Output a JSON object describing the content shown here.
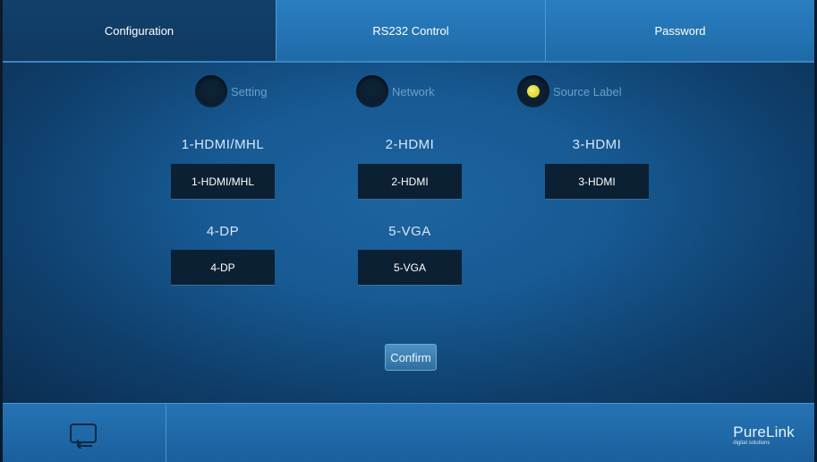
{
  "tabs": [
    {
      "label": "Configuration",
      "active": true
    },
    {
      "label": "RS232 Control",
      "active": false
    },
    {
      "label": "Password",
      "active": false
    }
  ],
  "mode_options": [
    {
      "label": "Setting",
      "selected": false
    },
    {
      "label": "Network",
      "selected": false
    },
    {
      "label": "Source Label",
      "selected": true
    }
  ],
  "sources": [
    {
      "title": "1-HDMI/MHL",
      "value": "1-HDMI/MHL"
    },
    {
      "title": "2-HDMI",
      "value": "2-HDMI"
    },
    {
      "title": "3-HDMI",
      "value": "3-HDMI"
    },
    {
      "title": "4-DP",
      "value": "4-DP"
    },
    {
      "title": "5-VGA",
      "value": "5-VGA"
    }
  ],
  "confirm_label": "Confirm",
  "brand": {
    "name": "PureLink",
    "tagline": "digital solutions"
  },
  "colors": {
    "accent": "#2a7fc0",
    "selected_dot": "#e6da2a",
    "background": "#175a94"
  }
}
